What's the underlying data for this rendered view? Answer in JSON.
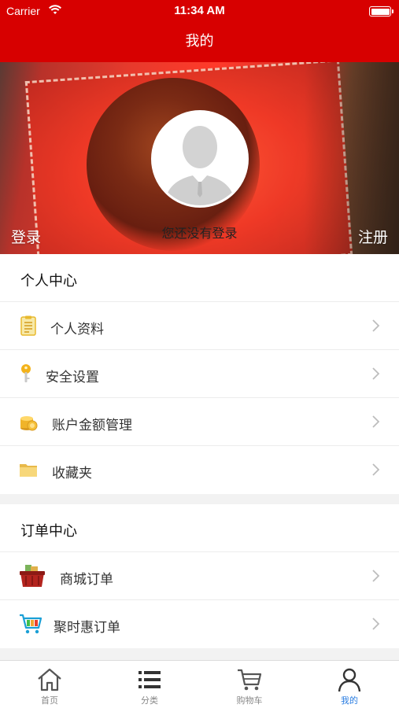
{
  "status_bar": {
    "carrier": "Carrier",
    "time": "11:34 AM"
  },
  "nav": {
    "title": "我的"
  },
  "banner": {
    "login_hint": "您还没有登录",
    "login": "登录",
    "register": "注册"
  },
  "personal_center": {
    "title": "个人中心",
    "items": [
      {
        "label": "个人资料",
        "icon": "clipboard-icon"
      },
      {
        "label": "安全设置",
        "icon": "key-icon"
      },
      {
        "label": "账户金额管理",
        "icon": "coins-icon"
      },
      {
        "label": "收藏夹",
        "icon": "folder-icon"
      }
    ]
  },
  "order_center": {
    "title": "订单中心",
    "items": [
      {
        "label": "商城订单",
        "icon": "basket-icon"
      },
      {
        "label": "聚时惠订单",
        "icon": "cart-icon"
      }
    ]
  },
  "tabbar": {
    "tabs": [
      {
        "label": "首页",
        "icon": "home-icon"
      },
      {
        "label": "分类",
        "icon": "list-icon"
      },
      {
        "label": "购物车",
        "icon": "cart-icon"
      },
      {
        "label": "我的",
        "icon": "person-icon"
      }
    ],
    "active_color": "#2a7de1",
    "active_index": 3
  },
  "colors": {
    "brand_red": "#d70000"
  }
}
